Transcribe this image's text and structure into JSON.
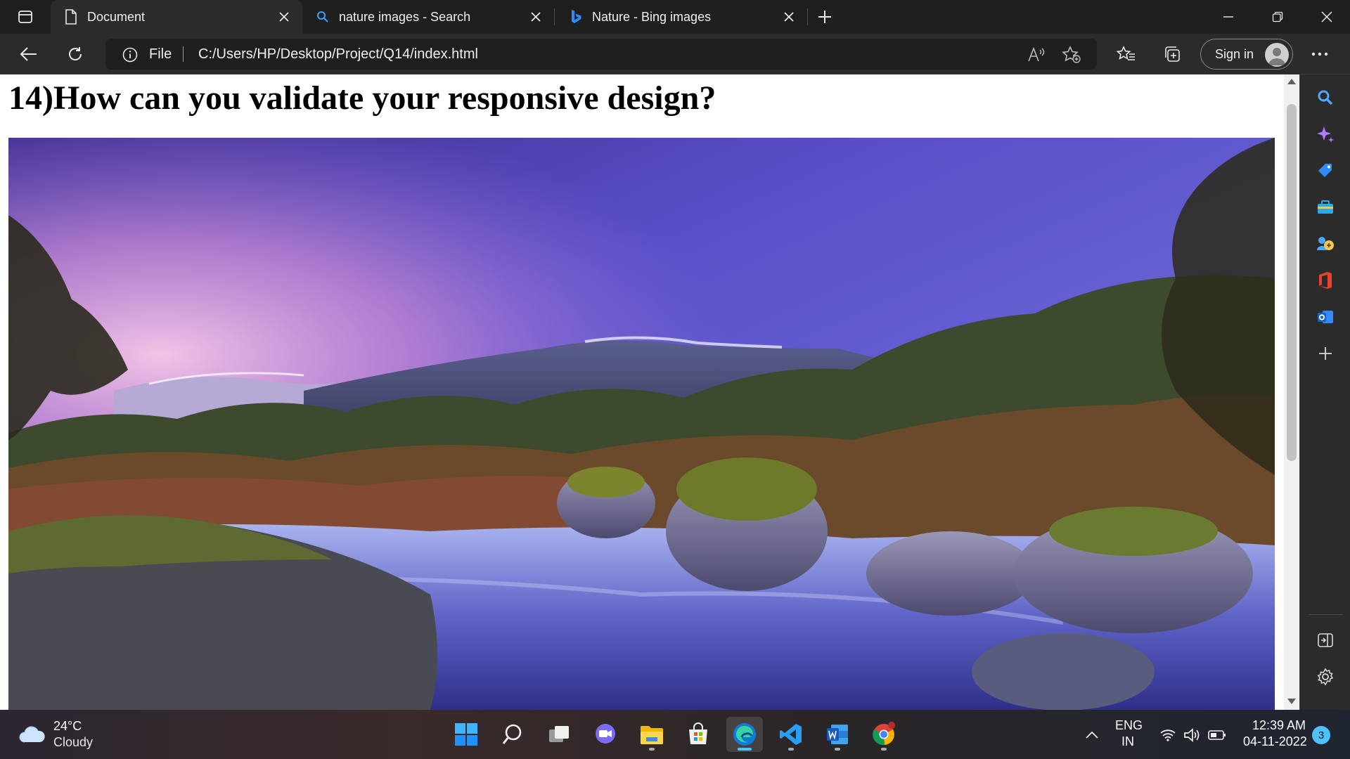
{
  "browser": {
    "tabs": [
      {
        "title": "Document",
        "icon": "document-icon",
        "active": true
      },
      {
        "title": "nature images - Search",
        "icon": "search-icon",
        "active": false
      },
      {
        "title": "Nature - Bing images",
        "icon": "bing-icon",
        "active": false
      }
    ],
    "address_bar": {
      "scheme_label": "File",
      "url": "C:/Users/HP/Desktop/Project/Q14/index.html"
    },
    "sign_in_label": "Sign in",
    "colors": {
      "accent": "#4cc2ff",
      "toolbar": "#2b2b2b",
      "tabstrip": "#1f1f1f"
    }
  },
  "page": {
    "heading": "14)How can you validate your responsive design?",
    "image_subject": "nature landscape photo"
  },
  "taskbar": {
    "weather": {
      "temperature": "24°C",
      "condition": "Cloudy"
    },
    "language": {
      "line1": "ENG",
      "line2": "IN"
    },
    "clock": {
      "time": "12:39 AM",
      "date": "04-11-2022"
    },
    "notification_count": "3"
  }
}
